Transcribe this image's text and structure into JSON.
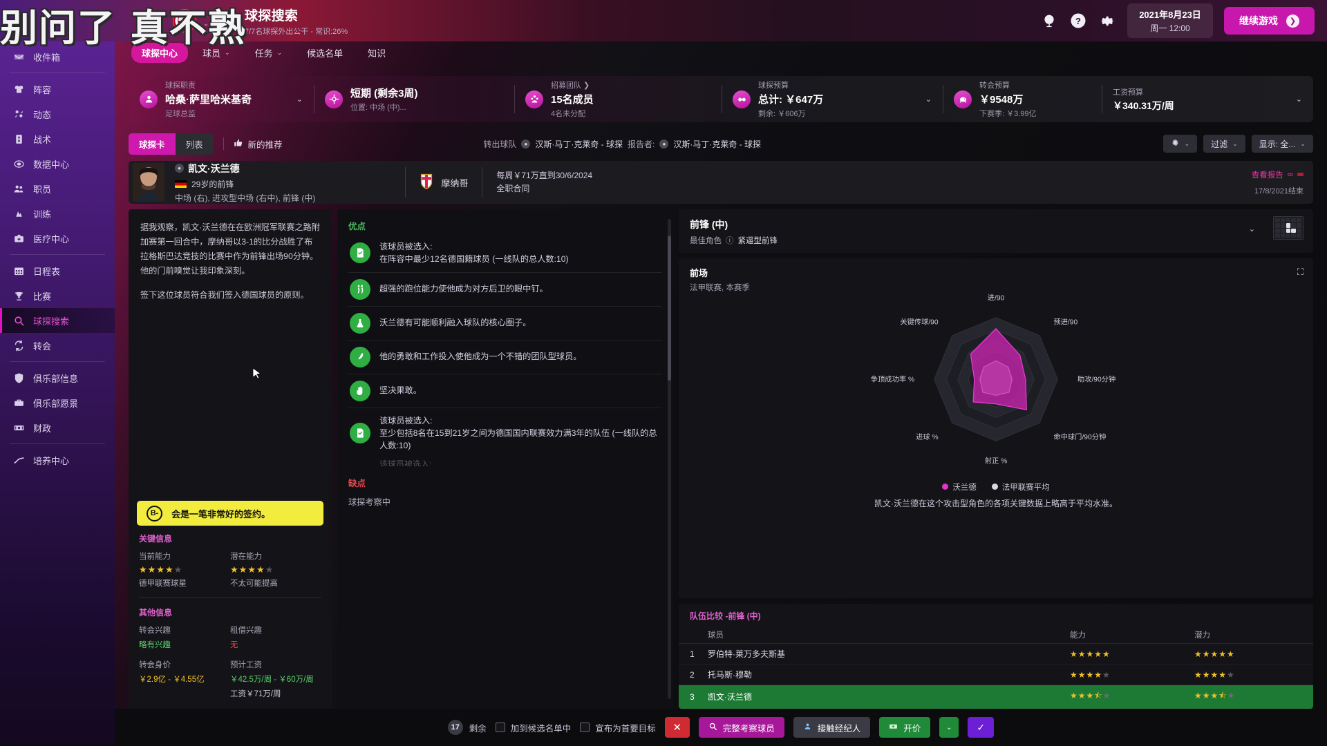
{
  "topbar": {
    "watermark": "别问了 真不熟",
    "title": "球探搜索",
    "subtitle": "7/7名球探外出公干 - 常识:26%",
    "search_icon": "search-icon",
    "globe_icon": "globe-icon",
    "help_icon": "help-icon",
    "settings_icon": "gear-icon",
    "date_line1": "2021年8月23日",
    "date_line2": "周一 12:00",
    "continue_label": "继续游戏"
  },
  "sidebar": {
    "items": [
      {
        "label": "收件箱",
        "icon": "inbox-icon",
        "active": false
      },
      {
        "label": "阵容",
        "icon": "squad-icon",
        "active": false
      },
      {
        "label": "动态",
        "icon": "dynamics-icon",
        "active": false
      },
      {
        "label": "战术",
        "icon": "tactics-icon",
        "active": false
      },
      {
        "label": "数据中心",
        "icon": "data-hub-icon",
        "active": false
      },
      {
        "label": "职员",
        "icon": "staff-icon",
        "active": false
      },
      {
        "label": "训练",
        "icon": "training-icon",
        "active": false
      },
      {
        "label": "医疗中心",
        "icon": "medical-icon",
        "active": false
      },
      {
        "label": "日程表",
        "icon": "schedule-icon",
        "active": false
      },
      {
        "label": "比赛",
        "icon": "trophy-icon",
        "active": false
      },
      {
        "label": "球探搜索",
        "icon": "scouting-icon",
        "active": true
      },
      {
        "label": "转会",
        "icon": "transfers-icon",
        "active": false
      },
      {
        "label": "俱乐部信息",
        "icon": "club-info-icon",
        "active": false
      },
      {
        "label": "俱乐部愿景",
        "icon": "club-vision-icon",
        "active": false
      },
      {
        "label": "财政",
        "icon": "finances-icon",
        "active": false
      },
      {
        "label": "培养中心",
        "icon": "development-icon",
        "active": false
      }
    ]
  },
  "nav_tabs": [
    {
      "label": "球探中心",
      "active": true,
      "caret": false
    },
    {
      "label": "球员",
      "active": false,
      "caret": true
    },
    {
      "label": "任务",
      "active": false,
      "caret": true
    },
    {
      "label": "候选名单",
      "active": false,
      "caret": false
    },
    {
      "label": "知识",
      "active": false,
      "caret": false
    }
  ],
  "filter_bar": [
    {
      "label": "球探职责",
      "value": "哈桑·萨里哈米基奇",
      "sub": "足球总监",
      "icon": "person-icon",
      "caret": true
    },
    {
      "label": "",
      "value": "短期 (剩余3周)",
      "sub": "位置: 中场 (中)...",
      "icon": "target-icon",
      "caret": false
    },
    {
      "label": "招募团队 ❯",
      "value": "15名成员",
      "sub": "4名未分配",
      "icon": "team-icon",
      "caret": false
    },
    {
      "label": "球探预算",
      "value": "总计: ￥647万",
      "sub": "剩余: ￥606万",
      "icon": "binoculars-icon",
      "caret": true
    },
    {
      "label": "转会预算",
      "value": "￥9548万",
      "sub": "下赛季: ￥3.99亿",
      "icon": "piggy-icon",
      "caret": false
    },
    {
      "label": "工资预算",
      "value": "￥340.31万/周",
      "sub": "",
      "icon": "wage-icon",
      "caret": true
    }
  ],
  "toolbar": {
    "seg": [
      {
        "label": "球探卡",
        "on": true
      },
      {
        "label": "列表",
        "on": false
      }
    ],
    "new_rec_label": "新的推荐",
    "new_rec_icon": "thumbs-up-icon",
    "mid_label1": "转出球队",
    "mid_val1": "汉斯·马丁·克莱奇 - 球探",
    "mid_label2": "报告者:",
    "mid_val2": "汉斯·马丁·克莱奇 - 球探",
    "gear_label": "",
    "gear_icon": "gear-icon",
    "filter_label": "过滤",
    "display_label": "显示: 全..."
  },
  "player": {
    "name": "凯文·沃兰德",
    "age_pos": "29岁的前锋",
    "positions": "中场 (右), 进攻型中场 (右中), 前锋 (中)",
    "club": "摩纳哥",
    "contract_line1": "每周￥71万直到30/6/2024",
    "contract_line2": "全职合同",
    "report_link": "查看报告",
    "report_date": "17/8/2021结束"
  },
  "report": {
    "paragraphs": [
      "据我观察，凯文·沃兰德在在欧洲冠军联赛之路附加赛第一回合中，摩纳哥以3-1的比分战胜了布拉格斯巴达竞技的比赛中作为前锋出场90分钟。他的门前嗅觉让我印象深刻。",
      "签下这位球员符合我们签入德国球员的原则。"
    ]
  },
  "verdict": {
    "grade": "B-",
    "text": "会是一笔非常好的签约。"
  },
  "key_info": {
    "title": "关键信息",
    "current_ability_label": "当前能力",
    "current_ability_stars": 4.5,
    "current_ability_note": "德甲联赛球星",
    "potential_ability_label": "潜在能力",
    "potential_ability_stars": 4.5,
    "potential_ability_note": "不太可能提高",
    "other_title": "其他信息",
    "transfer_interest_label": "转会兴趣",
    "transfer_interest_value": "略有兴趣",
    "loan_interest_label": "租借兴趣",
    "loan_interest_value": "无",
    "transfer_value_label": "转会身价",
    "transfer_value": "￥2.9亿 - ￥4.55亿",
    "expected_wage_label": "预计工资",
    "expected_wage": "￥42.5万/周 - ￥60万/周",
    "wage_line": "工资￥71万/周"
  },
  "strengths": {
    "title": "优点",
    "items": [
      {
        "text": "该球员被选入:\n在阵容中最少12名德国籍球员 (一线队的总人数:10)",
        "icon": "document-check-icon"
      },
      {
        "text": "超强的跑位能力使他成为对方后卫的眼中钉。",
        "icon": "run-icon"
      },
      {
        "text": "沃兰德有可能顺利融入球队的核心圈子。",
        "icon": "flask-icon"
      },
      {
        "text": "他的勇敢和工作投入使他成为一个不错的团队型球员。",
        "icon": "feather-icon"
      },
      {
        "text": "坚决果敢。",
        "icon": "hand-icon"
      },
      {
        "text": "该球员被选入:\n至少包括8名在15到21岁之间为德国国内联赛效力满3年的队伍 (一线队的总人数:10)",
        "icon": "document-check-icon"
      }
    ]
  },
  "weaknesses": {
    "title": "缺点",
    "text": "球探考察中"
  },
  "role_card": {
    "title": "前锋 (中)",
    "best_role_label": "最佳角色",
    "best_role_value": "紧逼型前锋",
    "info_icon": "info-icon"
  },
  "radar_card": {
    "heading": "前场",
    "sub": "法甲联赛, 本赛季",
    "expand_icon": "expand-icon",
    "note": "凯文·沃兰德在这个攻击型角色的各项关键数据上略高于平均水准。",
    "legend": [
      {
        "label": "沃兰德",
        "color": "#e235c6"
      },
      {
        "label": "法甲联赛平均",
        "color": "#d8d8e0"
      }
    ]
  },
  "chart_data": {
    "type": "radar",
    "title": "前场",
    "subtitle": "法甲联赛, 本赛季",
    "categories": [
      "进/90",
      "预进/90",
      "助攻/90分钟",
      "命中球门/90分钟",
      "射正 %",
      "进球 %",
      "争顶成功率 %",
      "关键传球/90"
    ],
    "series": [
      {
        "name": "沃兰德",
        "color": "#e235c6",
        "values": [
          0.82,
          0.55,
          0.48,
          0.7,
          0.4,
          0.52,
          0.35,
          0.58
        ]
      },
      {
        "name": "法甲联赛平均",
        "color": "#d8d8e0",
        "values": [
          0.3,
          0.28,
          0.26,
          0.3,
          0.26,
          0.3,
          0.26,
          0.28
        ]
      }
    ],
    "grid": true,
    "legend_position": "bottom"
  },
  "compare": {
    "title": "队伍比较 -前锋 (中)",
    "headers": [
      "球员",
      "能力",
      "潜力"
    ],
    "rows": [
      {
        "idx": "1",
        "player": "罗伯特·莱万多夫斯基",
        "ability": 5,
        "potential": 5,
        "highlight": false
      },
      {
        "idx": "2",
        "player": "托马斯·穆勒",
        "ability": 4,
        "potential": 4,
        "highlight": false
      },
      {
        "idx": "3",
        "player": "凯文·沃兰德",
        "ability": 3.5,
        "potential": 3.5,
        "highlight": true
      }
    ]
  },
  "bottom_bar": {
    "remaining_count": "17",
    "remaining_label": "剩余",
    "checkbox1": "加到候选名单中",
    "checkbox2": "宣布为首要目标",
    "reject_icon": "close-icon",
    "full_report_label": "完整考察球员",
    "full_report_icon": "search-icon",
    "agent_label": "接触经纪人",
    "agent_icon": "contact-icon",
    "offer_label": "开价",
    "offer_icon": "money-icon",
    "confirm_icon": "check-icon"
  }
}
